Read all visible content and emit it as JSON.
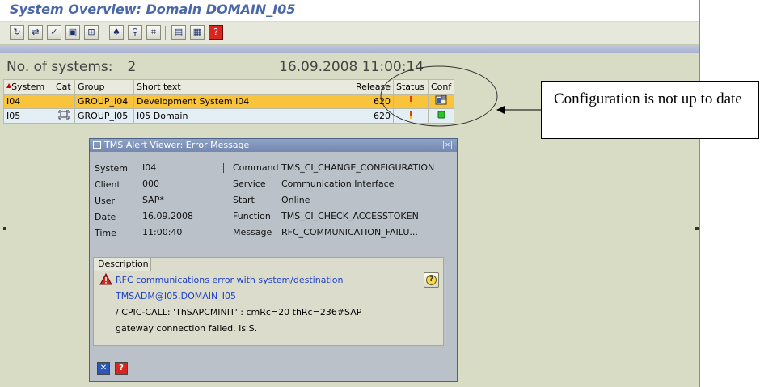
{
  "window": {
    "title": "System Overview: Domain DOMAIN_I05"
  },
  "toolbar": {
    "buttons": [
      {
        "icon": "refresh-icon",
        "glyph": "↻"
      },
      {
        "icon": "hierarchy-icon",
        "glyph": "⇄"
      },
      {
        "icon": "check-icon",
        "glyph": "✓"
      },
      {
        "icon": "lock-icon",
        "glyph": "▣"
      },
      {
        "icon": "tree-icon",
        "glyph": "⊞"
      },
      {
        "icon": "hat-icon",
        "glyph": "♠"
      },
      {
        "icon": "person-icon",
        "glyph": "⚲"
      },
      {
        "icon": "screen-icon",
        "glyph": "⌗"
      },
      {
        "icon": "layout-icon",
        "glyph": "▤"
      },
      {
        "icon": "grid-icon",
        "glyph": "▦"
      },
      {
        "icon": "help-icon",
        "glyph": "?"
      }
    ]
  },
  "summary": {
    "label": "No. of systems:",
    "count": "2",
    "timestamp": "16.09.2008 11:00:14"
  },
  "table": {
    "columns": [
      "System",
      "Cat",
      "Group",
      "Short text",
      "Release",
      "Status",
      "Conf"
    ],
    "rows": [
      {
        "system": "I04",
        "cat": "",
        "group": "GROUP_I04",
        "short_text": "Development System I04",
        "release": "620",
        "status_icon": "status-warning-icon",
        "conf_icon": "config-outdated-icon"
      },
      {
        "system": "I05",
        "cat": "domain-controller-icon",
        "group": "GROUP_I05",
        "short_text": "I05 Domain",
        "release": "620",
        "status_icon": "status-warning-icon",
        "conf_icon": "config-ok-icon"
      }
    ]
  },
  "annotation": {
    "text": "Configuration is not up to date"
  },
  "dialog": {
    "title": "TMS Alert Viewer: Error Message",
    "left": [
      {
        "label": "System",
        "value": "I04"
      },
      {
        "label": "Client",
        "value": "000"
      },
      {
        "label": "User",
        "value": "SAP*"
      },
      {
        "label": "Date",
        "value": "16.09.2008"
      },
      {
        "label": "Time",
        "value": "11:00:40"
      }
    ],
    "right": [
      {
        "label": "Command",
        "value": "TMS_CI_CHANGE_CONFIGURATION"
      },
      {
        "label": "Service",
        "value": "Communication Interface"
      },
      {
        "label": "Start",
        "value": "Online"
      },
      {
        "label": "Function",
        "value": "TMS_CI_CHECK_ACCESSTOKEN"
      },
      {
        "label": "Message",
        "value": "RFC_COMMUNICATION_FAILU..."
      }
    ],
    "description": {
      "tab": "Description",
      "lines": [
        "RFC communications error with system/destination",
        "TMSADM@I05.DOMAIN_I05",
        "/ CPIC-CALL: 'ThSAPCMINIT' : cmRc=20 thRc=236#SAP",
        "gateway connection failed. Is S."
      ]
    }
  },
  "colors": {
    "title_text": "#4a67a6",
    "selected_row": "#f9c33b",
    "row_alt": "#e4eef5",
    "dialog_bg": "#bac1c9",
    "desc_link": "#1d3fc4"
  }
}
